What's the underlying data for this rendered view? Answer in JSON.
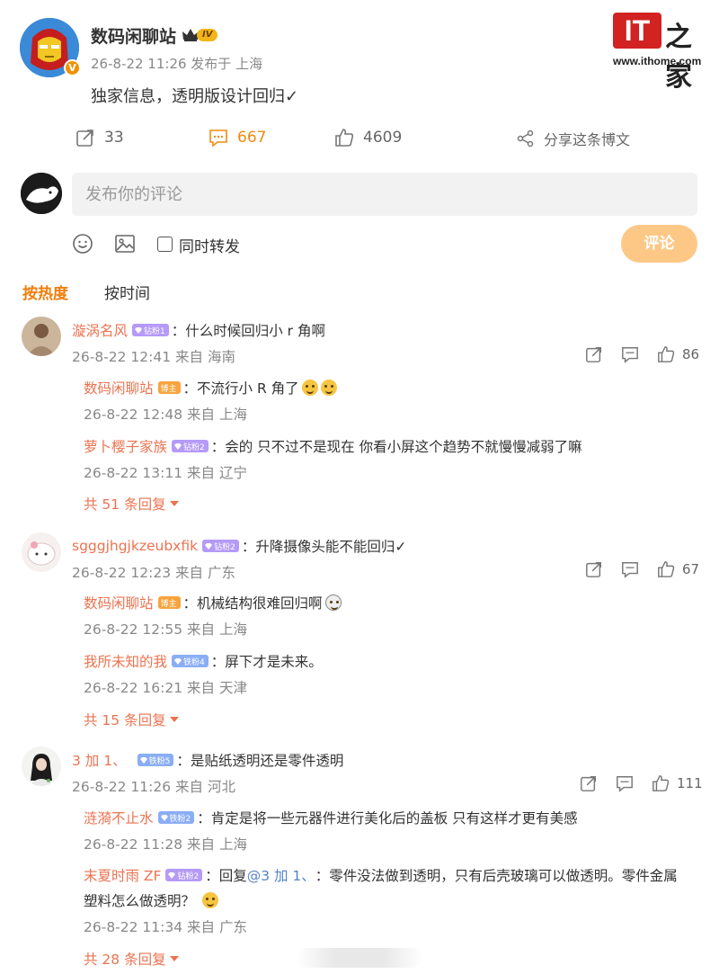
{
  "post": {
    "author": "数码闲聊站",
    "level": "IV",
    "verified_mark": "V",
    "meta": "26-8-22 11:26 发布于 上海",
    "text": "独家信息，透明版设计回归✓",
    "actions": {
      "repost": "33",
      "comments": "667",
      "likes": "4609",
      "share": "分享这条博文"
    }
  },
  "logo": {
    "it": "IT",
    "zh": "之家",
    "url": "www.ithome.com"
  },
  "compose": {
    "placeholder": "发布你的评论",
    "repost_checkbox": "同时转发",
    "submit": "评论"
  },
  "sort_tabs": {
    "hot": "按热度",
    "time": "按时间"
  },
  "colors": {
    "accent": "#f07d0b",
    "name": "#eb7350",
    "submit_bg": "#fdc886",
    "logo_red": "#d22222"
  },
  "comments": [
    {
      "user": "漩涡名风",
      "badge": "钻粉1",
      "text": "：什么时候回归小 r 角啊",
      "time": "26-8-22 12:41 来自 海南",
      "likes": "86",
      "replies": [
        {
          "user": "数码闲聊站",
          "badge": "博主",
          "text": "：不流行小 R 角了",
          "time": "26-8-22 12:48 来自 上海"
        },
        {
          "user": "萝卜樱子家族",
          "badge": "钻粉2",
          "text": "：会的 只不过不是现在 你看小屏这个趋势不就慢慢减弱了嘛",
          "time": "26-8-22 13:11 来自 辽宁"
        }
      ],
      "more": "共 51 条回复"
    },
    {
      "user": "sgggjhgjkzeubxfik",
      "badge": "钻粉2",
      "text": "：升降摄像头能不能回归✓",
      "time": "26-8-22 12:23 来自 广东",
      "likes": "67",
      "replies": [
        {
          "user": "数码闲聊站",
          "badge": "博主",
          "text": "：机械结构很难回归啊",
          "time": "26-8-22 12:55 来自 上海"
        },
        {
          "user": "我所未知的我",
          "badge": "铁粉4",
          "text": "：屏下才是未来。",
          "time": "26-8-22 16:21 来自 天津"
        }
      ],
      "more": "共 15 条回复"
    },
    {
      "user": "3 加 1、",
      "badge": "铁粉5",
      "text": "：是贴纸透明还是零件透明",
      "time": "26-8-22 11:26 来自 河北",
      "likes": "111",
      "replies": [
        {
          "user": "涟漪不止水",
          "badge": "铁粉2",
          "text": "：肯定是将一些元器件进行美化后的盖板 只有这样才更有美感",
          "time": "26-8-22 11:28 来自 上海"
        },
        {
          "user": "末夏时雨 ZF",
          "badge": "钻粉2",
          "reply_prefix": "：回复 ",
          "reply_to": "@3 加 1、",
          "text": "：零件没法做到透明，只有后壳玻璃可以做透明。零件金属",
          "text2": "塑料怎么做透明？",
          "time": "26-8-22 11:34 来自 广东"
        }
      ],
      "more": "共 28 条回复"
    }
  ]
}
